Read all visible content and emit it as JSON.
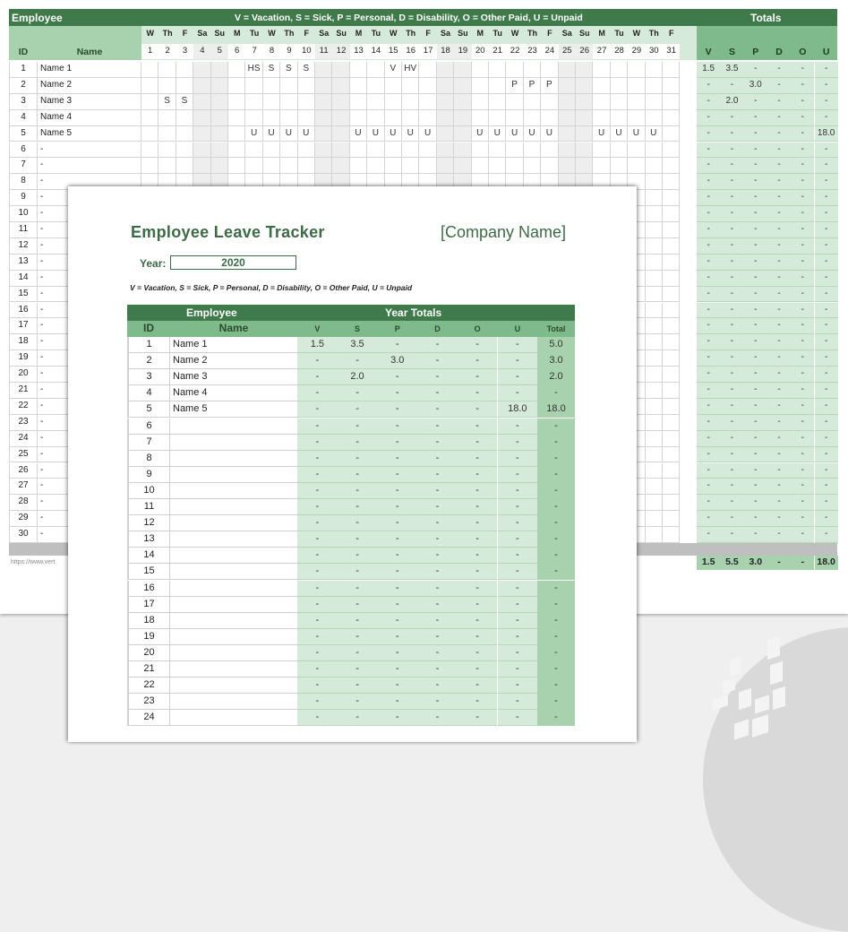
{
  "sheet": {
    "header_title": "Employee",
    "legend": "V = Vacation,  S = Sick, P = Personal, D = Disability, O = Other Paid, U = Unpaid",
    "totals_title": "Totals",
    "col_id": "ID",
    "col_name": "Name",
    "weekdays": [
      "W",
      "Th",
      "F",
      "Sa",
      "Su",
      "M",
      "Tu",
      "W",
      "Th",
      "F",
      "Sa",
      "Su",
      "M",
      "Tu",
      "W",
      "Th",
      "F",
      "Sa",
      "Su",
      "M",
      "Tu",
      "W",
      "Th",
      "F",
      "Sa",
      "Su",
      "M",
      "Tu",
      "W",
      "Th",
      "F"
    ],
    "days": [
      "1",
      "2",
      "3",
      "4",
      "5",
      "6",
      "7",
      "8",
      "9",
      "10",
      "11",
      "12",
      "13",
      "14",
      "15",
      "16",
      "17",
      "18",
      "19",
      "20",
      "21",
      "22",
      "23",
      "24",
      "25",
      "26",
      "27",
      "28",
      "29",
      "30",
      "31"
    ],
    "weekend_days": [
      4,
      5,
      11,
      12,
      18,
      19,
      25,
      26
    ],
    "total_headers": [
      "V",
      "S",
      "P",
      "D",
      "O",
      "U"
    ],
    "rows": [
      {
        "id": "1",
        "name": "Name 1",
        "marks": {
          "7": "HS",
          "8": "S",
          "9": "S",
          "10": "S",
          "15": "V",
          "16": "HV"
        },
        "totals": [
          "1.5",
          "3.5",
          "-",
          "-",
          "-",
          "-"
        ]
      },
      {
        "id": "2",
        "name": "Name 2",
        "marks": {
          "22": "P",
          "23": "P",
          "24": "P"
        },
        "totals": [
          "-",
          "-",
          "3.0",
          "-",
          "-",
          "-"
        ]
      },
      {
        "id": "3",
        "name": "Name 3",
        "marks": {
          "2": "S",
          "3": "S"
        },
        "totals": [
          "-",
          "2.0",
          "-",
          "-",
          "-",
          "-"
        ]
      },
      {
        "id": "4",
        "name": "Name 4",
        "marks": {},
        "totals": [
          "-",
          "-",
          "-",
          "-",
          "-",
          "-"
        ]
      },
      {
        "id": "5",
        "name": "Name 5",
        "marks": {
          "7": "U",
          "8": "U",
          "9": "U",
          "10": "U",
          "13": "U",
          "14": "U",
          "15": "U",
          "16": "U",
          "17": "U",
          "20": "U",
          "21": "U",
          "22": "U",
          "23": "U",
          "24": "U",
          "27": "U",
          "28": "U",
          "29": "U",
          "30": "U"
        },
        "totals": [
          "-",
          "-",
          "-",
          "-",
          "-",
          "18.0"
        ]
      },
      {
        "id": "6",
        "name": "-",
        "marks": {},
        "totals": [
          "-",
          "-",
          "-",
          "-",
          "-",
          "-"
        ]
      },
      {
        "id": "7",
        "name": "-",
        "marks": {},
        "totals": [
          "-",
          "-",
          "-",
          "-",
          "-",
          "-"
        ]
      },
      {
        "id": "8",
        "name": "-",
        "marks": {},
        "totals": [
          "-",
          "-",
          "-",
          "-",
          "-",
          "-"
        ]
      },
      {
        "id": "9",
        "name": "-",
        "marks": {},
        "totals": [
          "-",
          "-",
          "-",
          "-",
          "-",
          "-"
        ]
      },
      {
        "id": "10",
        "name": "-",
        "marks": {},
        "totals": [
          "-",
          "-",
          "-",
          "-",
          "-",
          "-"
        ]
      },
      {
        "id": "11",
        "name": "-",
        "marks": {},
        "totals": [
          "-",
          "-",
          "-",
          "-",
          "-",
          "-"
        ]
      },
      {
        "id": "12",
        "name": "-",
        "marks": {},
        "totals": [
          "-",
          "-",
          "-",
          "-",
          "-",
          "-"
        ]
      },
      {
        "id": "13",
        "name": "-",
        "marks": {},
        "totals": [
          "-",
          "-",
          "-",
          "-",
          "-",
          "-"
        ]
      },
      {
        "id": "14",
        "name": "-",
        "marks": {},
        "totals": [
          "-",
          "-",
          "-",
          "-",
          "-",
          "-"
        ]
      },
      {
        "id": "15",
        "name": "-",
        "marks": {},
        "totals": [
          "-",
          "-",
          "-",
          "-",
          "-",
          "-"
        ]
      },
      {
        "id": "16",
        "name": "-",
        "marks": {},
        "totals": [
          "-",
          "-",
          "-",
          "-",
          "-",
          "-"
        ]
      },
      {
        "id": "17",
        "name": "-",
        "marks": {},
        "totals": [
          "-",
          "-",
          "-",
          "-",
          "-",
          "-"
        ]
      },
      {
        "id": "18",
        "name": "-",
        "marks": {},
        "totals": [
          "-",
          "-",
          "-",
          "-",
          "-",
          "-"
        ]
      },
      {
        "id": "19",
        "name": "-",
        "marks": {},
        "totals": [
          "-",
          "-",
          "-",
          "-",
          "-",
          "-"
        ]
      },
      {
        "id": "20",
        "name": "-",
        "marks": {},
        "totals": [
          "-",
          "-",
          "-",
          "-",
          "-",
          "-"
        ]
      },
      {
        "id": "21",
        "name": "-",
        "marks": {},
        "totals": [
          "-",
          "-",
          "-",
          "-",
          "-",
          "-"
        ]
      },
      {
        "id": "22",
        "name": "-",
        "marks": {},
        "totals": [
          "-",
          "-",
          "-",
          "-",
          "-",
          "-"
        ]
      },
      {
        "id": "23",
        "name": "-",
        "marks": {},
        "totals": [
          "-",
          "-",
          "-",
          "-",
          "-",
          "-"
        ]
      },
      {
        "id": "24",
        "name": "-",
        "marks": {},
        "totals": [
          "-",
          "-",
          "-",
          "-",
          "-",
          "-"
        ]
      },
      {
        "id": "25",
        "name": "-",
        "marks": {},
        "totals": [
          "-",
          "-",
          "-",
          "-",
          "-",
          "-"
        ]
      },
      {
        "id": "26",
        "name": "-",
        "marks": {},
        "totals": [
          "-",
          "-",
          "-",
          "-",
          "-",
          "-"
        ]
      },
      {
        "id": "27",
        "name": "-",
        "marks": {},
        "totals": [
          "-",
          "-",
          "-",
          "-",
          "-",
          "-"
        ]
      },
      {
        "id": "28",
        "name": "-",
        "marks": {},
        "totals": [
          "-",
          "-",
          "-",
          "-",
          "-",
          "-"
        ]
      },
      {
        "id": "29",
        "name": "-",
        "marks": {},
        "totals": [
          "-",
          "-",
          "-",
          "-",
          "-",
          "-"
        ]
      },
      {
        "id": "30",
        "name": "-",
        "marks": {},
        "totals": [
          "-",
          "-",
          "-",
          "-",
          "-",
          "-"
        ]
      }
    ],
    "grand_totals": [
      "1.5",
      "5.5",
      "3.0",
      "-",
      "-",
      "18.0"
    ],
    "url_text": "https://www.vert"
  },
  "report": {
    "title": "Employee Leave Tracker",
    "company": "[Company Name]",
    "year_label": "Year:",
    "year_value": "2020",
    "legend": "V = Vacation,  S = Sick, P = Personal, D = Disability, O = Other Paid, U = Unpaid",
    "group_employee": "Employee",
    "group_year_totals": "Year Totals",
    "col_id": "ID",
    "col_name": "Name",
    "total_headers": [
      "V",
      "S",
      "P",
      "D",
      "O",
      "U"
    ],
    "col_total": "Total",
    "rows": [
      {
        "id": "1",
        "name": "Name 1",
        "values": [
          "1.5",
          "3.5",
          "-",
          "-",
          "-",
          "-"
        ],
        "total": "5.0"
      },
      {
        "id": "2",
        "name": "Name 2",
        "values": [
          "-",
          "-",
          "3.0",
          "-",
          "-",
          "-"
        ],
        "total": "3.0"
      },
      {
        "id": "3",
        "name": "Name 3",
        "values": [
          "-",
          "2.0",
          "-",
          "-",
          "-",
          "-"
        ],
        "total": "2.0"
      },
      {
        "id": "4",
        "name": "Name 4",
        "values": [
          "-",
          "-",
          "-",
          "-",
          "-",
          "-"
        ],
        "total": "-"
      },
      {
        "id": "5",
        "name": "Name 5",
        "values": [
          "-",
          "-",
          "-",
          "-",
          "-",
          "18.0"
        ],
        "total": "18.0"
      },
      {
        "id": "6",
        "name": "",
        "values": [
          "-",
          "-",
          "-",
          "-",
          "-",
          "-"
        ],
        "total": "-"
      },
      {
        "id": "7",
        "name": "",
        "values": [
          "-",
          "-",
          "-",
          "-",
          "-",
          "-"
        ],
        "total": "-"
      },
      {
        "id": "8",
        "name": "",
        "values": [
          "-",
          "-",
          "-",
          "-",
          "-",
          "-"
        ],
        "total": "-"
      },
      {
        "id": "9",
        "name": "",
        "values": [
          "-",
          "-",
          "-",
          "-",
          "-",
          "-"
        ],
        "total": "-"
      },
      {
        "id": "10",
        "name": "",
        "values": [
          "-",
          "-",
          "-",
          "-",
          "-",
          "-"
        ],
        "total": "-"
      },
      {
        "id": "11",
        "name": "",
        "values": [
          "-",
          "-",
          "-",
          "-",
          "-",
          "-"
        ],
        "total": "-"
      },
      {
        "id": "12",
        "name": "",
        "values": [
          "-",
          "-",
          "-",
          "-",
          "-",
          "-"
        ],
        "total": "-"
      },
      {
        "id": "13",
        "name": "",
        "values": [
          "-",
          "-",
          "-",
          "-",
          "-",
          "-"
        ],
        "total": "-"
      },
      {
        "id": "14",
        "name": "",
        "values": [
          "-",
          "-",
          "-",
          "-",
          "-",
          "-"
        ],
        "total": "-"
      },
      {
        "id": "15",
        "name": "",
        "values": [
          "-",
          "-",
          "-",
          "-",
          "-",
          "-"
        ],
        "total": "-"
      },
      {
        "id": "16",
        "name": "",
        "values": [
          "-",
          "-",
          "-",
          "-",
          "-",
          "-"
        ],
        "total": "-"
      },
      {
        "id": "17",
        "name": "",
        "values": [
          "-",
          "-",
          "-",
          "-",
          "-",
          "-"
        ],
        "total": "-"
      },
      {
        "id": "18",
        "name": "",
        "values": [
          "-",
          "-",
          "-",
          "-",
          "-",
          "-"
        ],
        "total": "-"
      },
      {
        "id": "19",
        "name": "",
        "values": [
          "-",
          "-",
          "-",
          "-",
          "-",
          "-"
        ],
        "total": "-"
      },
      {
        "id": "20",
        "name": "",
        "values": [
          "-",
          "-",
          "-",
          "-",
          "-",
          "-"
        ],
        "total": "-"
      },
      {
        "id": "21",
        "name": "",
        "values": [
          "-",
          "-",
          "-",
          "-",
          "-",
          "-"
        ],
        "total": "-"
      },
      {
        "id": "22",
        "name": "",
        "values": [
          "-",
          "-",
          "-",
          "-",
          "-",
          "-"
        ],
        "total": "-"
      },
      {
        "id": "23",
        "name": "",
        "values": [
          "-",
          "-",
          "-",
          "-",
          "-",
          "-"
        ],
        "total": "-"
      },
      {
        "id": "24",
        "name": "",
        "values": [
          "-",
          "-",
          "-",
          "-",
          "-",
          "-"
        ],
        "total": "-"
      }
    ]
  },
  "colors": {
    "header_dark_green": "#3f7a4a",
    "header_mid_green": "#7fba8a",
    "light_green": "#d6ead9",
    "total_green": "#a8d1ae",
    "weekend_gray": "#efefef",
    "title_green": "#3d6b45"
  },
  "icons": {
    "background_logo": "vertex-logo-icon"
  }
}
